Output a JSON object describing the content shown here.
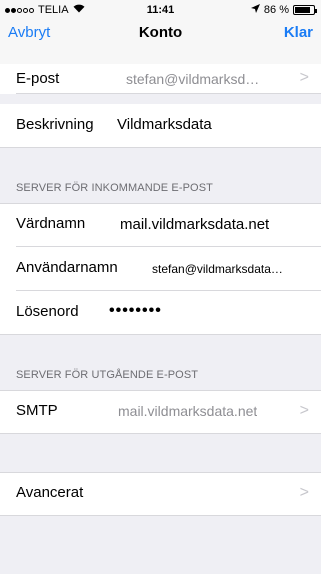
{
  "status_bar": {
    "carrier": "TELIA",
    "time": "11:41",
    "battery_percent": "86 %",
    "battery_level": 0.86,
    "signal_dots": [
      true,
      true,
      false,
      false,
      false
    ]
  },
  "nav": {
    "left_label": "Avbryt",
    "title": "Konto",
    "right_label": "Klar"
  },
  "account": {
    "email_label": "E-post",
    "email_value": "stefan@vildmarksd…",
    "description_label": "Beskrivning",
    "description_value": "Vildmarksdata"
  },
  "incoming": {
    "header": "SERVER FÖR INKOMMANDE E-POST",
    "hostname_label": "Värdnamn",
    "hostname_value": "mail.vildmarksdata.net",
    "username_label": "Användarnamn",
    "username_value": "stefan@vildmarksdata…",
    "password_label": "Lösenord",
    "password_value": "••••••••"
  },
  "outgoing": {
    "header": "SERVER FÖR UTGÅENDE E-POST",
    "smtp_label": "SMTP",
    "smtp_value": "mail.vildmarksdata.net"
  },
  "advanced": {
    "label": "Avancerat"
  },
  "colors": {
    "accent": "#1a7cf5",
    "background": "#efeff4",
    "secondary_text": "#8e8e93"
  }
}
